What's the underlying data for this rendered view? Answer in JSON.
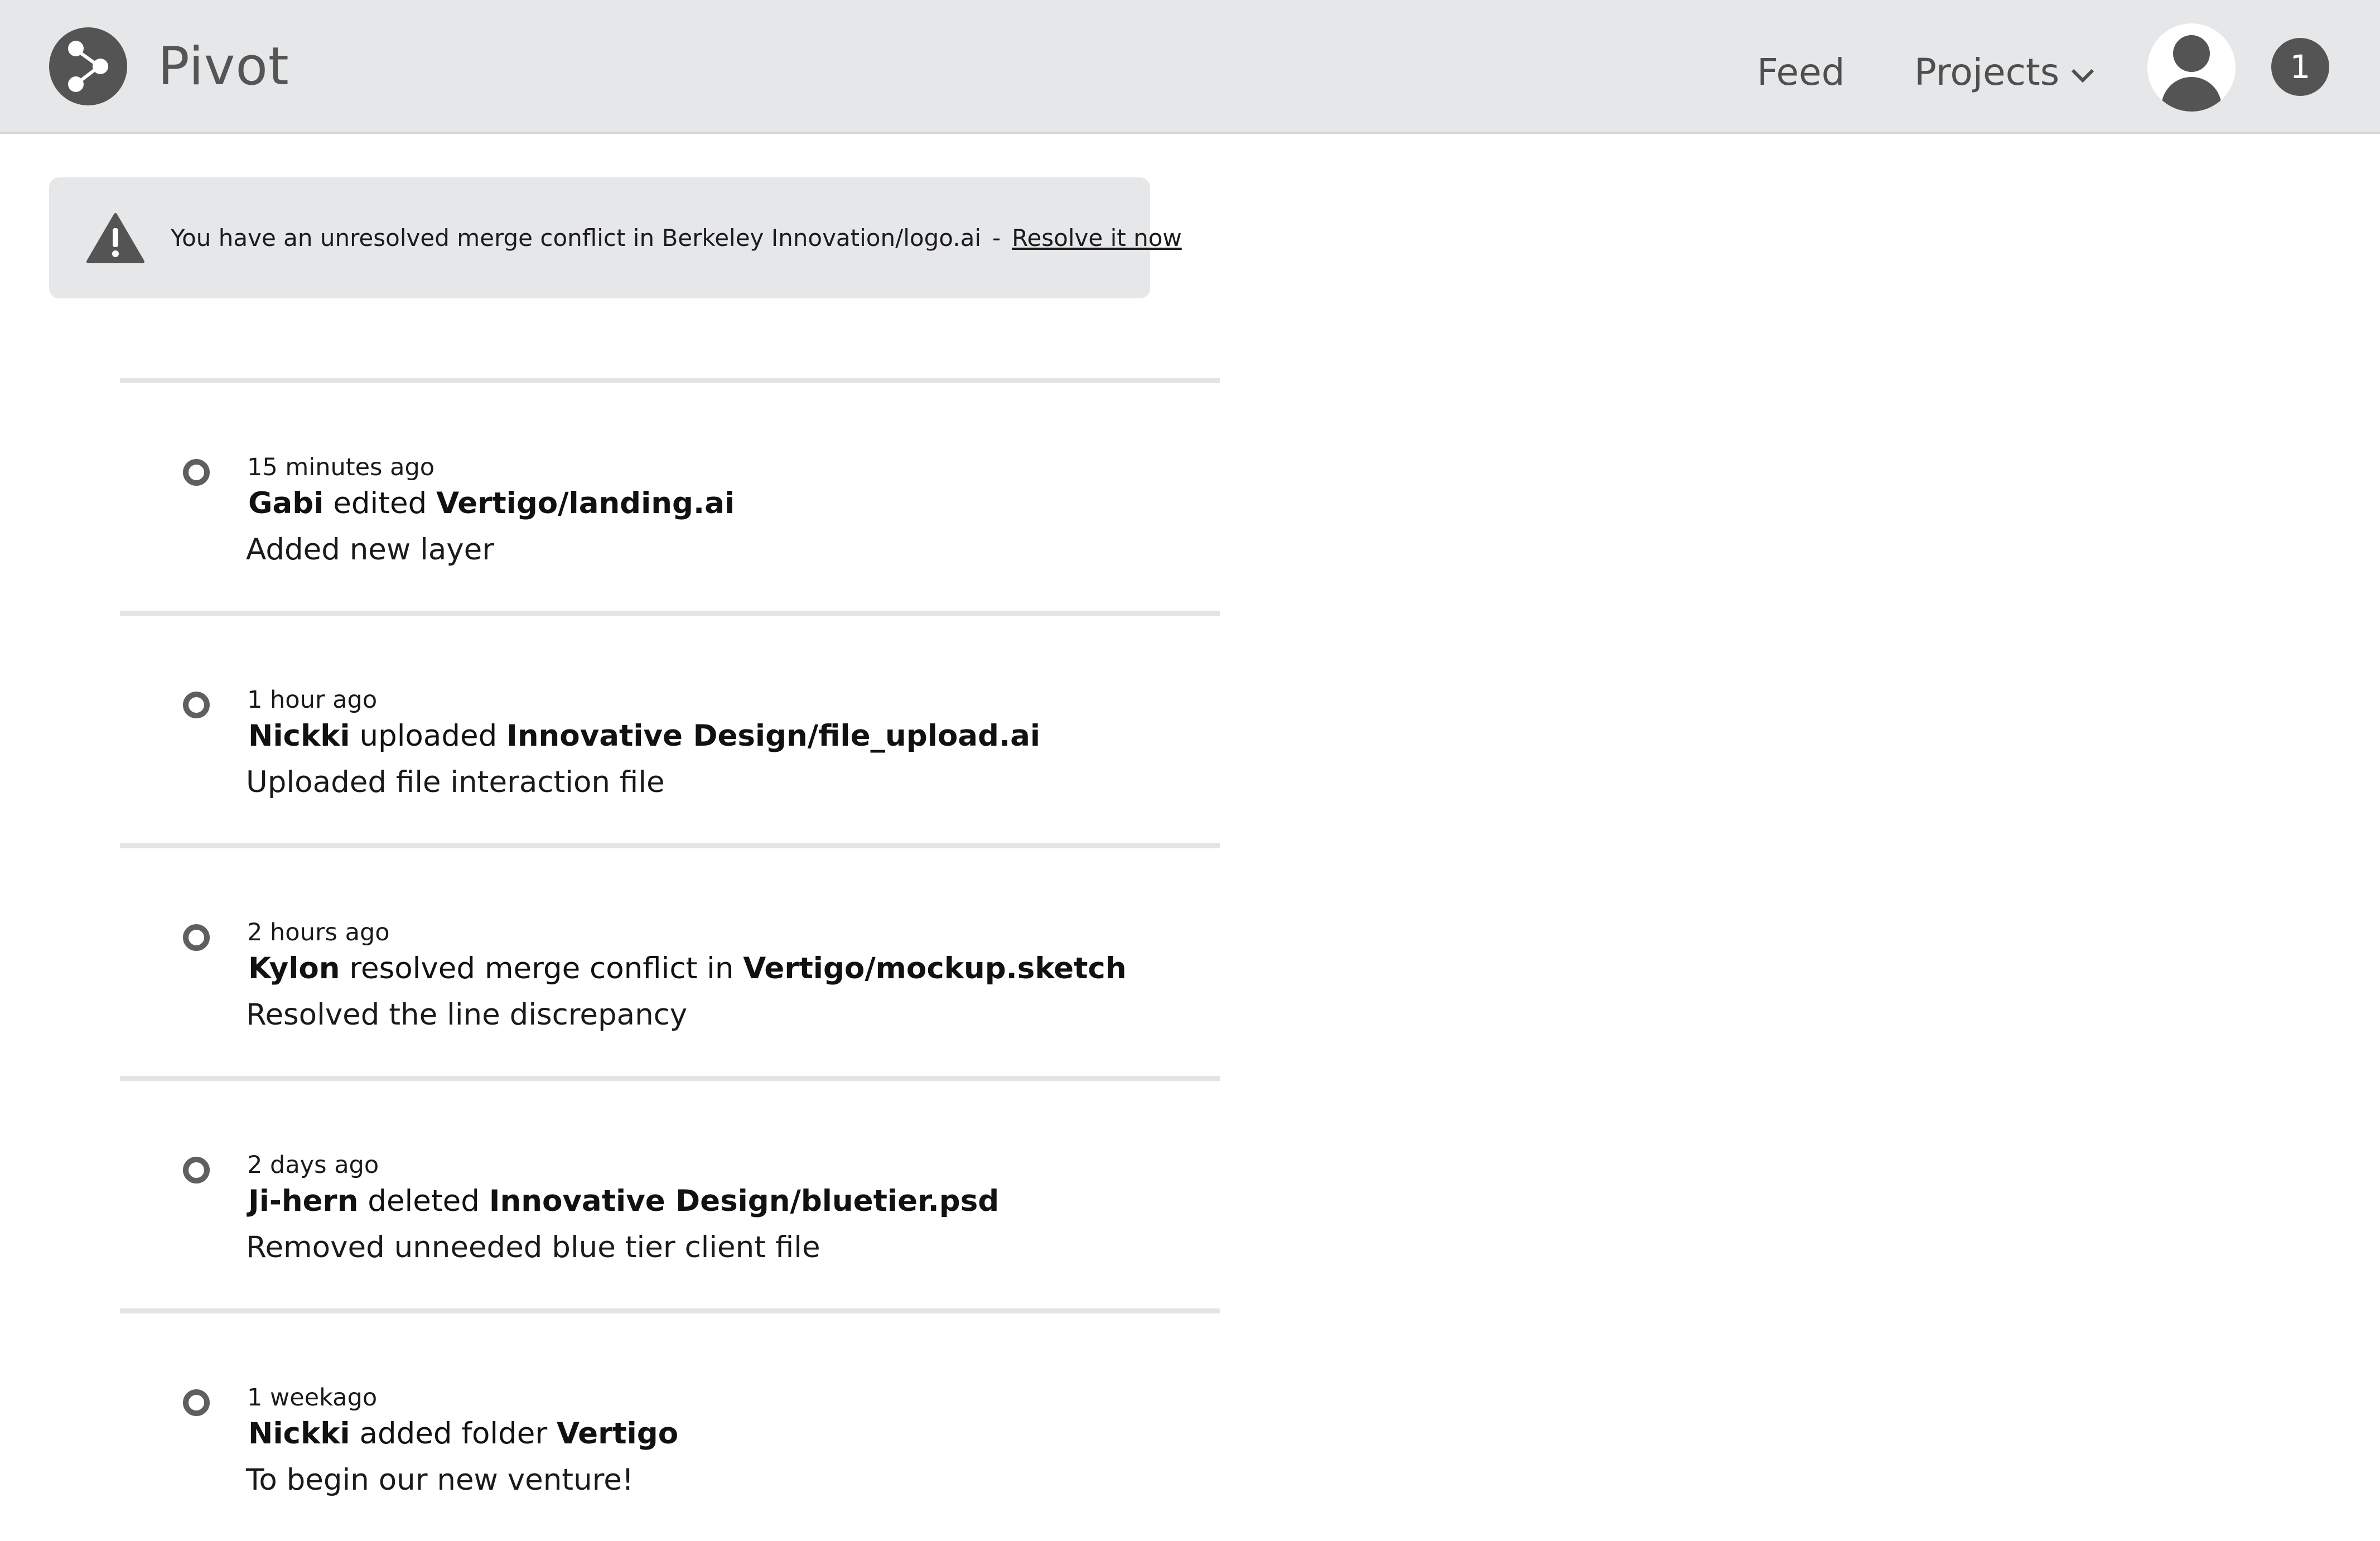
{
  "header": {
    "app_name": "Pivot",
    "nav": {
      "feed": "Feed",
      "projects": "Projects"
    },
    "notification_count": "1",
    "logo_icon": "share-network-icon",
    "avatar_icon": "user-avatar-icon",
    "bar_color": "#e6e7e9",
    "icon_color": "#545454"
  },
  "alert": {
    "icon": "warning-triangle-icon",
    "message": "You have an unresolved merge conflict in Berkeley Innovation/logo.ai",
    "separator": "-",
    "action": "Resolve it now"
  },
  "feed": {
    "items": [
      {
        "time": "15 minutes ago",
        "user": "Gabi",
        "action": "edited",
        "target": "Vertigo/landing.ai",
        "message": "Added new layer"
      },
      {
        "time": "1 hour ago",
        "user": "Nickki",
        "action": "uploaded",
        "target": "Innovative Design/file_upload.ai",
        "message": "Uploaded file interaction file"
      },
      {
        "time": "2 hours ago",
        "user": "Kylon",
        "action": "resolved merge conflict in",
        "target": "Vertigo/mockup.sketch",
        "message": "Resolved the line discrepancy"
      },
      {
        "time": "2 days ago",
        "user": "Ji-hern",
        "action": "deleted",
        "target": "Innovative Design/bluetier.psd",
        "message": "Removed unneeded blue tier client file"
      },
      {
        "time": "1 weekago",
        "user": "Nickki",
        "action": "added folder",
        "target": "Vertigo",
        "message": "To begin our new venture!"
      }
    ]
  }
}
